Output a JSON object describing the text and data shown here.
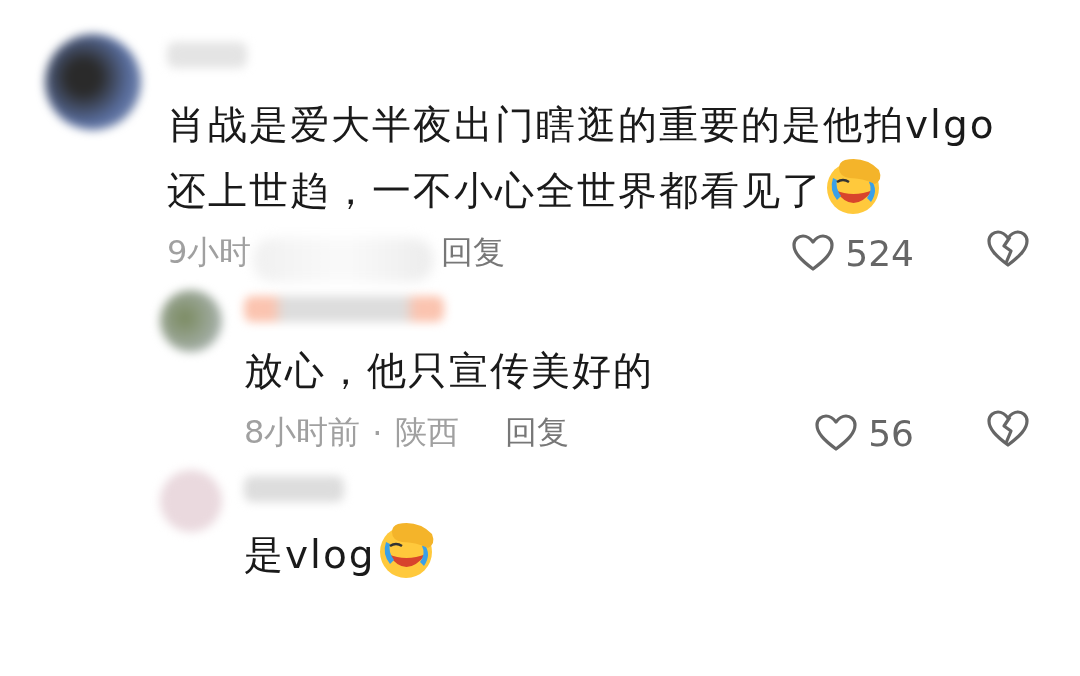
{
  "comment": {
    "text": "肖战是爱大半夜出门瞎逛的重要的是他拍vlgo还上世趋，一不小心全世界都看见了",
    "trailing_emoji": true,
    "time": "9小时",
    "reply": "回复",
    "likes": "524",
    "replies": [
      {
        "text": "放心，他只宣传美好的",
        "trailing_emoji": false,
        "time": "8小时前",
        "separator": "·",
        "location": "陕西",
        "reply": "回复",
        "likes": "56"
      },
      {
        "text": "是vlog",
        "trailing_emoji": true
      }
    ]
  }
}
